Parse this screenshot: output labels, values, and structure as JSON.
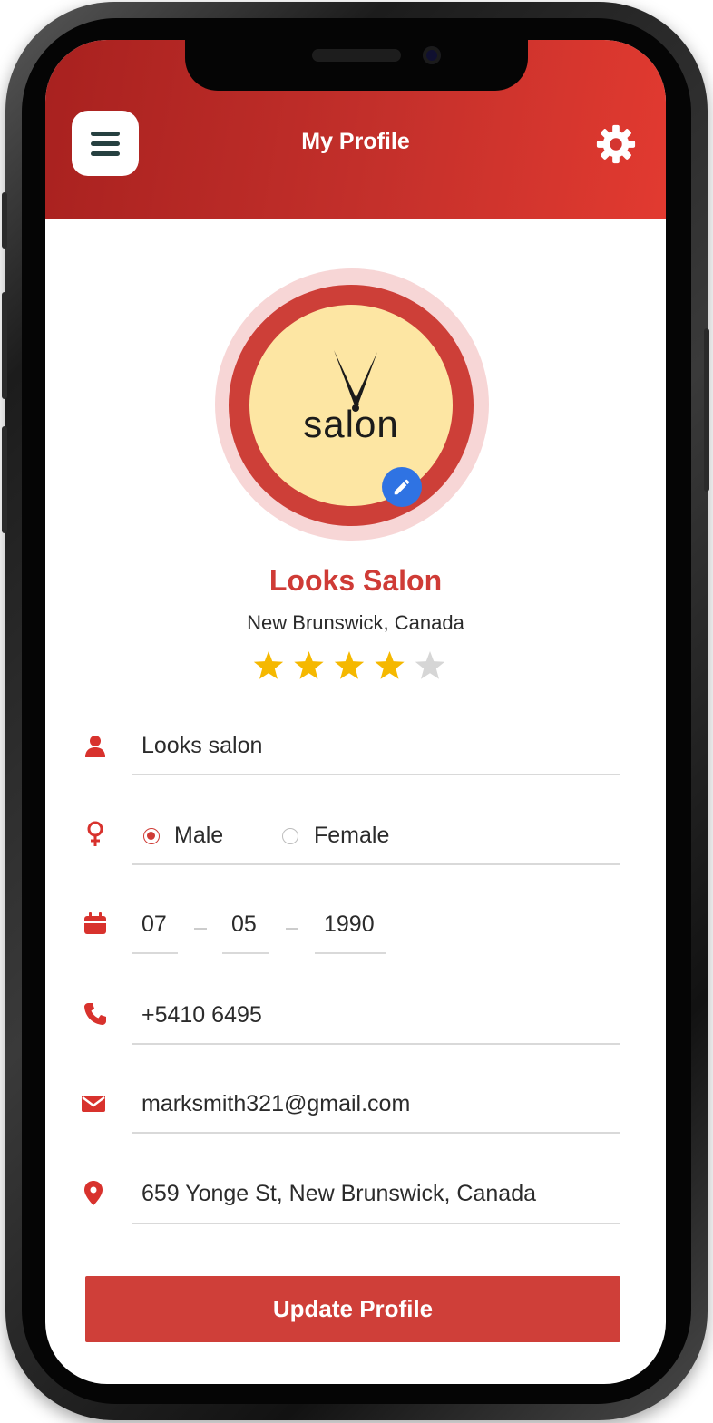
{
  "header": {
    "title": "My Profile",
    "menu_icon": "hamburger-menu-icon",
    "settings_icon": "gear-icon"
  },
  "profile": {
    "logo_text": "salon",
    "name": "Looks Salon",
    "location": "New Brunswick, Canada",
    "rating": 4,
    "rating_max": 5
  },
  "form": {
    "name": {
      "icon": "user-icon",
      "value": "Looks salon"
    },
    "gender": {
      "icon": "female-symbol-icon",
      "options": [
        "Male",
        "Female"
      ],
      "selected": "Male"
    },
    "dob": {
      "icon": "calendar-icon",
      "day": "07",
      "month": "05",
      "year": "1990"
    },
    "phone": {
      "icon": "phone-icon",
      "value": "+5410 6495"
    },
    "email": {
      "icon": "envelope-icon",
      "value": "marksmith321@gmail.com"
    },
    "address": {
      "icon": "map-pin-icon",
      "value": "659 Yonge St, New Brunswick, Canada"
    }
  },
  "actions": {
    "update_label": "Update Profile"
  },
  "colors": {
    "accent": "#cf3b36",
    "header_start": "#a8211f",
    "header_end": "#e23a30",
    "star_filled": "#f5b800",
    "star_empty": "#d6d6d6",
    "edit_button": "#2f73e3"
  }
}
